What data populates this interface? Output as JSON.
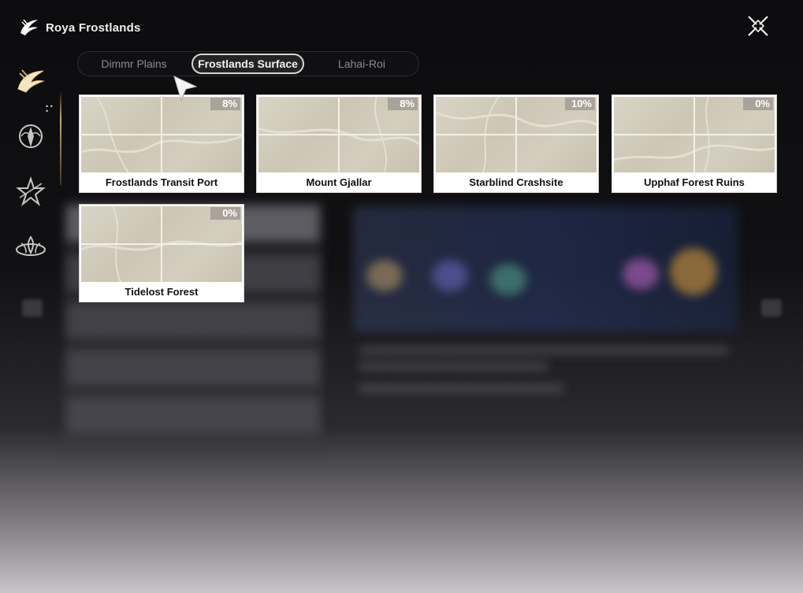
{
  "header": {
    "title": "Roya Frostlands"
  },
  "tabs": [
    {
      "label": "Dimmr Plains",
      "active": false
    },
    {
      "label": "Frostlands Surface",
      "active": true
    },
    {
      "label": "Lahai-Roi",
      "active": false
    }
  ],
  "rail": {
    "items": [
      {
        "icon": "frostlands-emblem-icon",
        "active": true
      },
      {
        "icon": "goddess-emblem-icon",
        "active": false
      },
      {
        "icon": "star-emblem-icon",
        "active": false
      },
      {
        "icon": "lotus-emblem-icon",
        "active": false
      }
    ]
  },
  "locations": [
    {
      "name": "Frostlands Transit Port",
      "progress": "8%"
    },
    {
      "name": "Mount Gjallar",
      "progress": "8%"
    },
    {
      "name": "Starblind Crashsite",
      "progress": "10%"
    },
    {
      "name": "Upphaf Forest Ruins",
      "progress": "0%"
    },
    {
      "name": "Tidelost Forest",
      "progress": "0%"
    }
  ],
  "colors": {
    "accent_gold": "#e6c882",
    "badge_bg": "#a9a39a",
    "card_bg": "#ffffff"
  }
}
